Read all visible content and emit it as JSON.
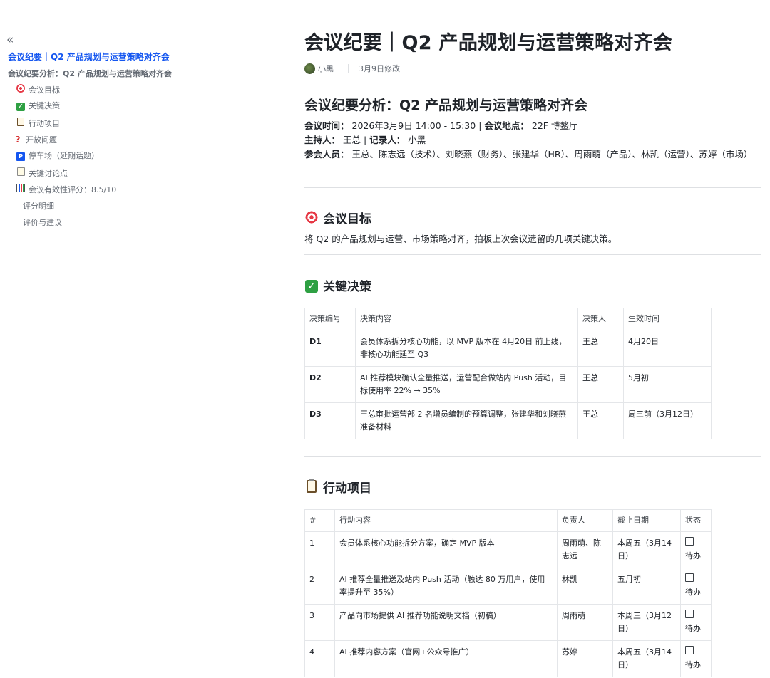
{
  "toc": {
    "collapse_icon": "«",
    "title": "会议纪要｜Q2 产品规划与运营策略对齐会",
    "h1": "会议纪要分析：Q2 产品规划与运营策略对齐会",
    "items": [
      {
        "icon": "target-icon",
        "label": "会议目标"
      },
      {
        "icon": "check-icon",
        "label": "关键决策"
      },
      {
        "icon": "clipboard-icon",
        "label": "行动项目"
      },
      {
        "icon": "question-icon",
        "label": "开放问题"
      },
      {
        "icon": "parking-icon",
        "label": "停车场（延期话题）"
      },
      {
        "icon": "memo-icon",
        "label": "关键讨论点"
      },
      {
        "icon": "chart-icon",
        "label": "会议有效性评分：8.5/10"
      },
      {
        "icon": "",
        "label": "评分明细"
      },
      {
        "icon": "",
        "label": "评价与建议"
      }
    ]
  },
  "doc": {
    "title": "会议纪要｜Q2 产品规划与运营策略对齐会",
    "author": "小黑",
    "modified": "3月9日修改",
    "h2": "会议纪要分析：Q2 产品规划与运营策略对齐会",
    "info": {
      "time_label": "会议时间：",
      "time_value": "2026年3月9日 14:00 - 15:30",
      "place_label": "会议地点：",
      "place_value": "22F 博鳌厅",
      "host_label": "主持人：",
      "host_value": "王总",
      "recorder_label": "记录人：",
      "recorder_value": "小黑",
      "attendees_label": "参会人员：",
      "attendees_value": "王总、陈志远（技术）、刘晓燕（财务）、张建华（HR）、周雨萌（产品）、林凯（运营）、苏婷（市场）",
      "sep": "|"
    },
    "goal": {
      "heading": "会议目标",
      "text": "将 Q2 的产品规划与运营、市场策略对齐，拍板上次会议遗留的几项关键决策。"
    },
    "decisions": {
      "heading": "关键决策",
      "columns": [
        "决策编号",
        "决策内容",
        "决策人",
        "生效时间"
      ],
      "rows": [
        {
          "id": "D1",
          "content": "会员体系拆分核心功能，以 MVP 版本在 4月20日 前上线，非核心功能延至 Q3",
          "owner": "王总",
          "time": "4月20日"
        },
        {
          "id": "D2",
          "content": "AI 推荐模块确认全量推送，运营配合做站内 Push 活动，目标使用率 22% → 35%",
          "owner": "王总",
          "time": "5月初"
        },
        {
          "id": "D3",
          "content": "王总审批运营部 2 名增员编制的预算调整，张建华和刘晓燕准备材料",
          "owner": "王总",
          "time": "周三前（3月12日）"
        }
      ]
    },
    "actions": {
      "heading": "行动项目",
      "columns": [
        "#",
        "行动内容",
        "负责人",
        "截止日期",
        "状态"
      ],
      "rows": [
        {
          "n": "1",
          "content": "会员体系核心功能拆分方案，确定 MVP 版本",
          "owner": "周雨萌、陈志远",
          "due": "本周五（3月14日）",
          "status": "待办"
        },
        {
          "n": "2",
          "content": "AI 推荐全量推送及站内 Push 活动（触达 80 万用户，使用率提升至 35%）",
          "owner": "林凯",
          "due": "五月初",
          "status": "待办"
        },
        {
          "n": "3",
          "content": "产品向市场提供 AI 推荐功能说明文档（初稿）",
          "owner": "周雨萌",
          "due": "本周三（3月12日）",
          "status": "待办"
        },
        {
          "n": "4",
          "content": "AI 推荐内容方案（官网+公众号推广）",
          "owner": "苏婷",
          "due": "本周五（3月14日）",
          "status": "待办"
        }
      ]
    }
  }
}
